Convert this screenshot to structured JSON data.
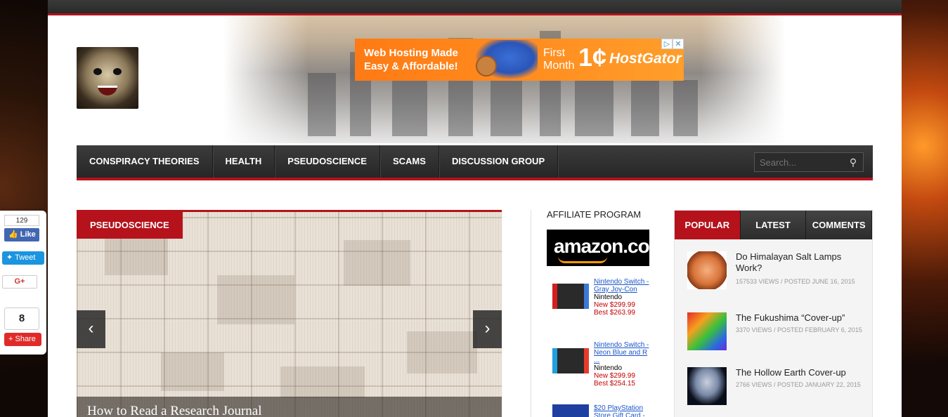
{
  "ad": {
    "line1": "Web Hosting Made",
    "line2": "Easy & Affordable!",
    "first": "First",
    "month": "Month",
    "price": "1¢",
    "brand": "HostGator",
    "choice_icon": "▷",
    "close_icon": "✕"
  },
  "nav": {
    "items": [
      "CONSPIRACY THEORIES",
      "HEALTH",
      "PSEUDOSCIENCE",
      "SCAMS",
      "DISCUSSION GROUP"
    ],
    "search_placeholder": "Search..."
  },
  "slider": {
    "category": "PSEUDOSCIENCE",
    "caption": "How to Read a Research Journal",
    "prev": "‹",
    "next": "›"
  },
  "affiliate": {
    "title": "AFFILIATE PROGRAM",
    "logo_text": "amazon.com",
    "products": [
      {
        "title": "Nintendo Switch - Gray Joy-Con",
        "brand": "Nintendo",
        "new_price": "New $299.99",
        "best_price": "Best $263.99"
      },
      {
        "title": "Nintendo Switch - Neon Blue and R ...",
        "brand": "Nintendo",
        "new_price": "New $299.99",
        "best_price": "Best $254.15"
      },
      {
        "title": "$20 PlayStation Store Gift Card -",
        "brand": "",
        "new_price": "",
        "best_price": ""
      }
    ]
  },
  "tabs": {
    "labels": [
      "POPULAR",
      "LATEST",
      "COMMENTS"
    ],
    "active": "POPULAR"
  },
  "popular": [
    {
      "title": "Do Himalayan Salt Lamps Work?",
      "meta": "157533 VIEWS / POSTED JUNE 16, 2015"
    },
    {
      "title": "The Fukushima “Cover-up”",
      "meta": "3370 VIEWS / POSTED FEBRUARY 6, 2015"
    },
    {
      "title": "The Hollow Earth Cover-up",
      "meta": "2766 VIEWS / POSTED JANUARY 22, 2015"
    }
  ],
  "share": {
    "fb_count": "129",
    "fb_like": "Like",
    "tweet": "Tweet",
    "gplus": "G+",
    "share_count": "8",
    "share_label": "Share"
  },
  "colors": {
    "accent": "#b5121b",
    "nav_bg": "#2e2e2e",
    "link": "#1a55c8"
  }
}
